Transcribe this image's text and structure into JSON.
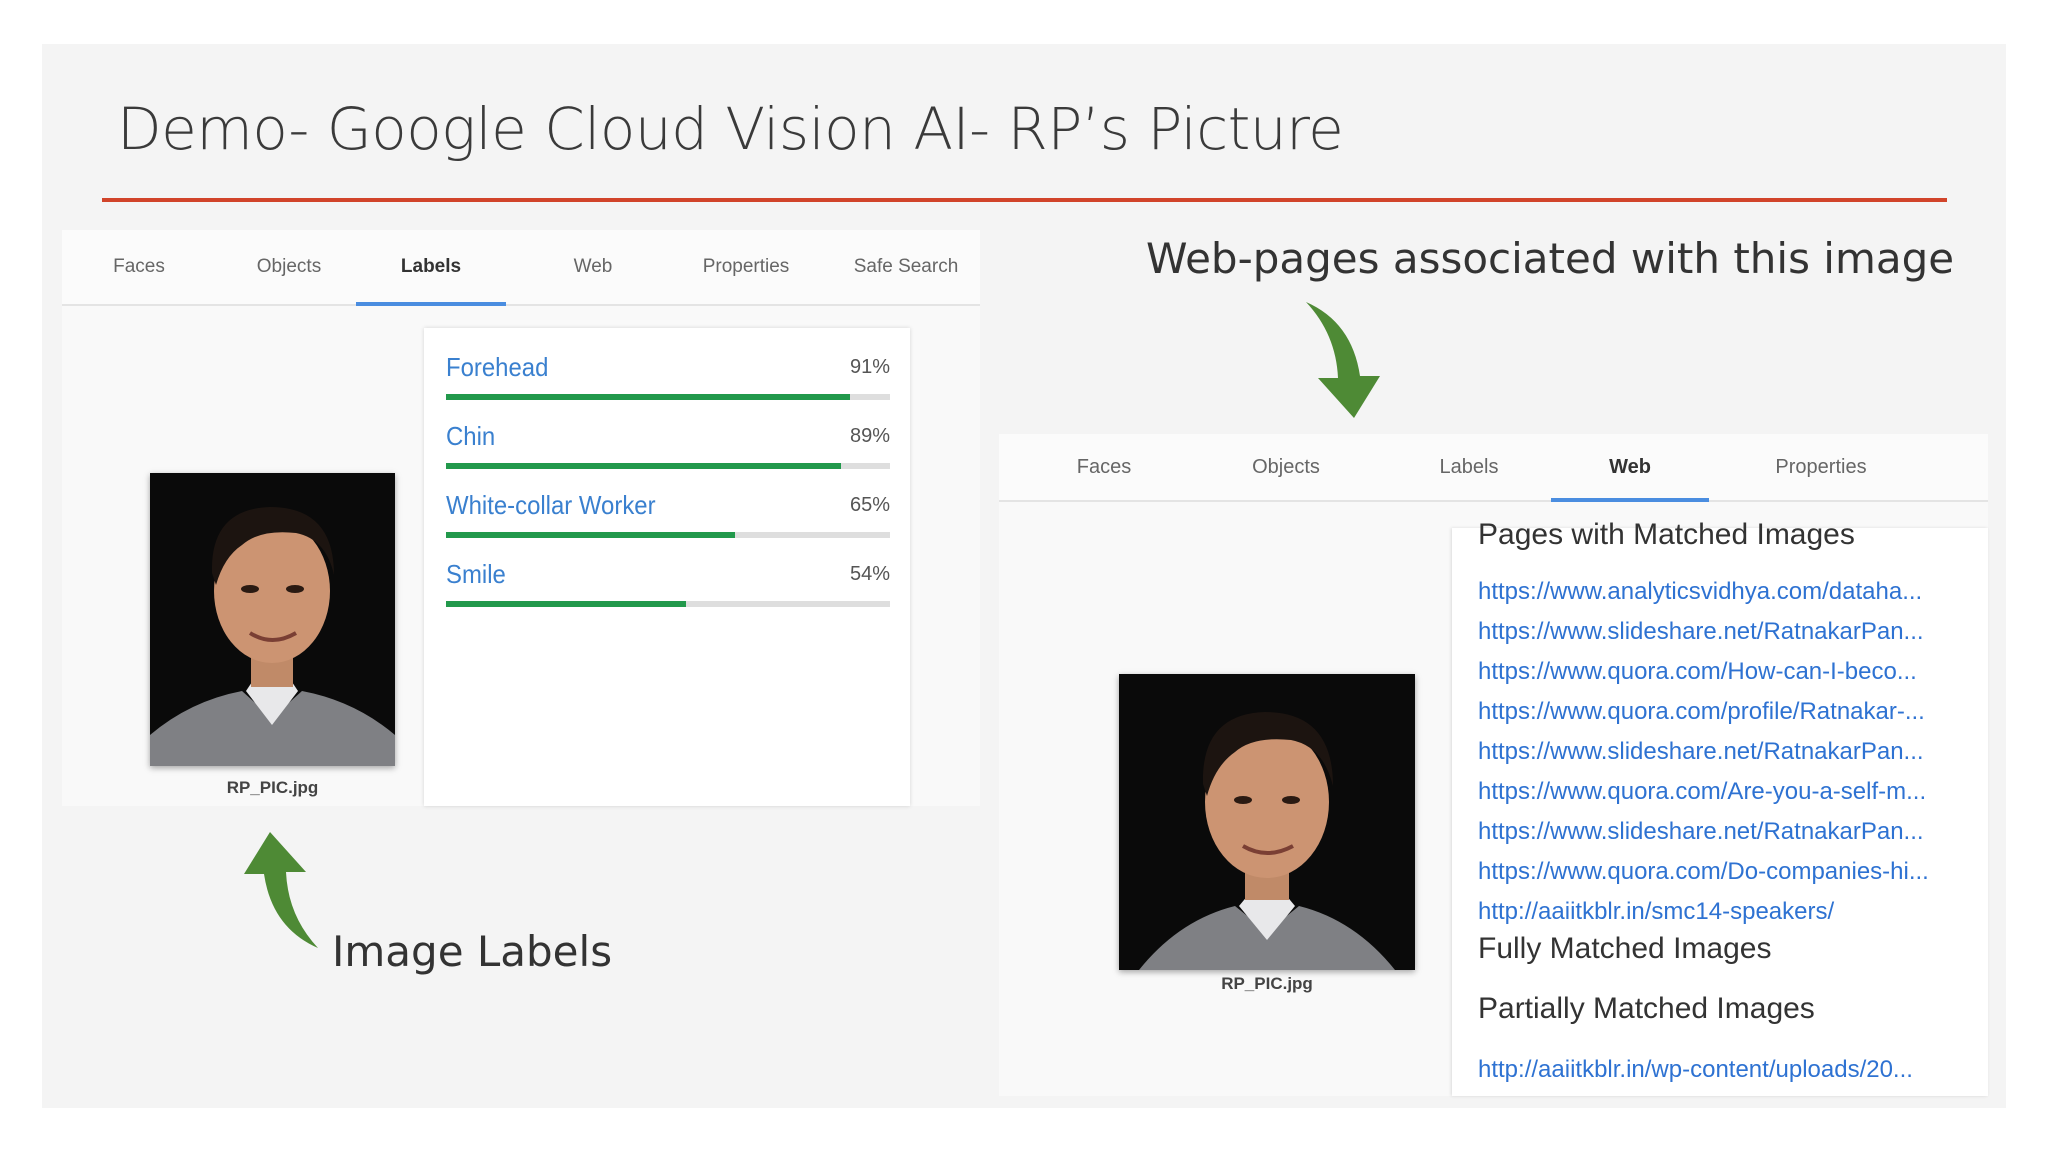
{
  "slide": {
    "title": "Demo- Google Cloud Vision AI- RP’s Picture",
    "accent_color": "#d1442a"
  },
  "left_panel": {
    "tabs": [
      {
        "label": "Faces"
      },
      {
        "label": "Objects"
      },
      {
        "label": "Labels",
        "active": true
      },
      {
        "label": "Web"
      },
      {
        "label": "Properties"
      },
      {
        "label": "Safe Search"
      }
    ],
    "image_caption": "RP_PIC.jpg",
    "labels": [
      {
        "name": "Forehead",
        "percent": "91%",
        "value": 0.91
      },
      {
        "name": "Chin",
        "percent": "89%",
        "value": 0.89
      },
      {
        "name": "White-collar Worker",
        "percent": "65%",
        "value": 0.65
      },
      {
        "name": "Smile",
        "percent": "54%",
        "value": 0.54
      }
    ],
    "bar_color": "#22994c"
  },
  "right_panel": {
    "tabs": [
      {
        "label": "Faces"
      },
      {
        "label": "Objects"
      },
      {
        "label": "Labels"
      },
      {
        "label": "Web",
        "active": true
      },
      {
        "label": "Properties"
      }
    ],
    "image_caption": "RP_PIC.jpg",
    "pages_heading": "Pages with Matched Images",
    "pages": [
      "https://www.analyticsvidhya.com/dataha...",
      "https://www.slideshare.net/RatnakarPan...",
      "https://www.quora.com/How-can-I-beco...",
      "https://www.quora.com/profile/Ratnakar-...",
      "https://www.slideshare.net/RatnakarPan...",
      "https://www.quora.com/Are-you-a-self-m...",
      "https://www.slideshare.net/RatnakarPan...",
      "https://www.quora.com/Do-companies-hi...",
      "http://aaiitkblr.in/smc14-speakers/"
    ],
    "fully_heading": "Fully Matched Images",
    "partial_heading": "Partially Matched Images",
    "partial_links": [
      "http://aaiitkblr.in/wp-content/uploads/20..."
    ],
    "link_color": "#2e72d2"
  },
  "annotations": {
    "web_pages": "Web-pages associated with this image",
    "image_labels": "Image Labels",
    "arrow_color": "#4e8a35"
  }
}
